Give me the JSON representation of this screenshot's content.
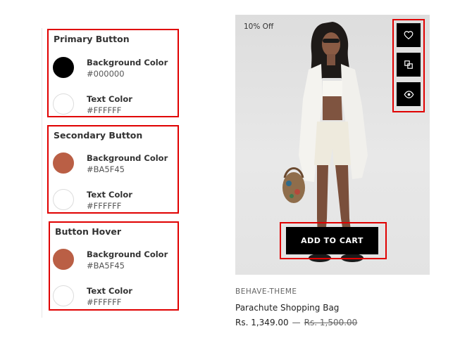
{
  "settings": [
    {
      "title": "Primary Button",
      "rows": [
        {
          "label": "Background Color",
          "value": "#000000",
          "color": "#000000"
        },
        {
          "label": "Text Color",
          "value": "#FFFFFF",
          "color": "#FFFFFF"
        }
      ]
    },
    {
      "title": "Secondary Button",
      "rows": [
        {
          "label": "Background Color",
          "value": "#BA5F45",
          "color": "#BA5F45"
        },
        {
          "label": "Text Color",
          "value": "#FFFFFF",
          "color": "#FFFFFF"
        }
      ]
    },
    {
      "title": "Button Hover",
      "rows": [
        {
          "label": "Background Color",
          "value": "#BA5F45",
          "color": "#BA5F45"
        },
        {
          "label": "Text Color",
          "value": "#FFFFFF",
          "color": "#FFFFFF"
        }
      ]
    }
  ],
  "product": {
    "badge": "10% Off",
    "quick_actions": [
      "heart-icon",
      "compare-icon",
      "eye-icon"
    ],
    "add_to_cart": "ADD TO CART",
    "vendor": "BEHAVE-THEME",
    "title": "Parachute Shopping Bag",
    "price": "Rs. 1,349.00",
    "separator": "—",
    "compare_price": "Rs. 1,500.00"
  }
}
